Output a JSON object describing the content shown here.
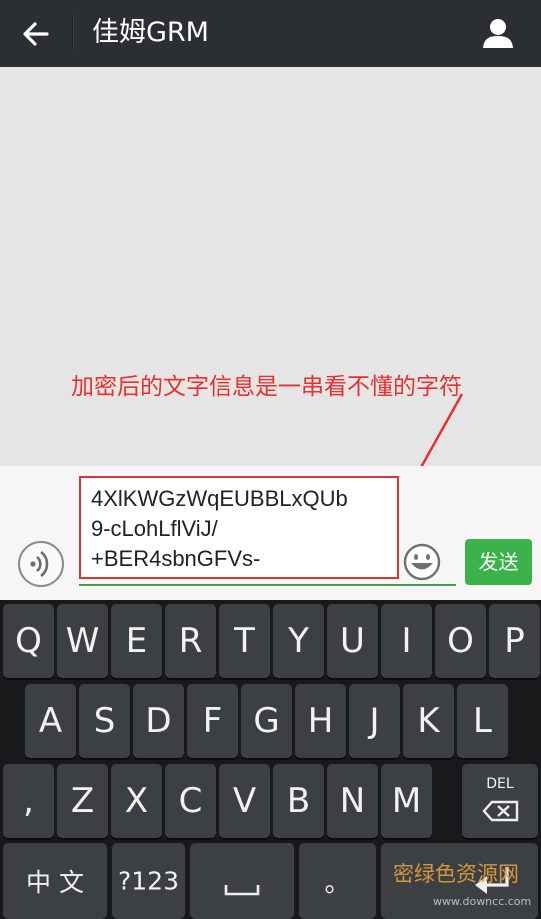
{
  "header": {
    "title": "佳姆GRM",
    "back_icon": "arrow-left-icon",
    "profile_icon": "user-icon"
  },
  "chat": {
    "annotation": "加密后的文字信息是一串看不懂的字符"
  },
  "input": {
    "message_value": "4XlKWGzWqEUBBLxQUb\n9-cLohLflViJ/\n+BER4sbnGFVs-",
    "send_label": "发送",
    "voice_icon": "voice-wave-icon",
    "emoji_icon": "smiley-icon"
  },
  "keyboard": {
    "row1": [
      "Q",
      "W",
      "E",
      "R",
      "T",
      "Y",
      "U",
      "I",
      "O",
      "P"
    ],
    "row2": [
      "A",
      "S",
      "D",
      "F",
      "G",
      "H",
      "J",
      "K",
      "L"
    ],
    "row3": [
      ",",
      "Z",
      "X",
      "C",
      "V",
      "B",
      "N",
      "M"
    ],
    "del_label": "DEL",
    "lang_label": "中 文",
    "num_label": "?123",
    "dot_label": "。",
    "space_icon": "space-bar-icon",
    "enter_icon": "enter-icon"
  },
  "watermark": {
    "text": "密绿色资源网",
    "url": "www.downcc.com"
  },
  "colors": {
    "topbar": "#2b2f33",
    "accent_green": "#3cb34a",
    "annotation_red": "#e8312f"
  }
}
